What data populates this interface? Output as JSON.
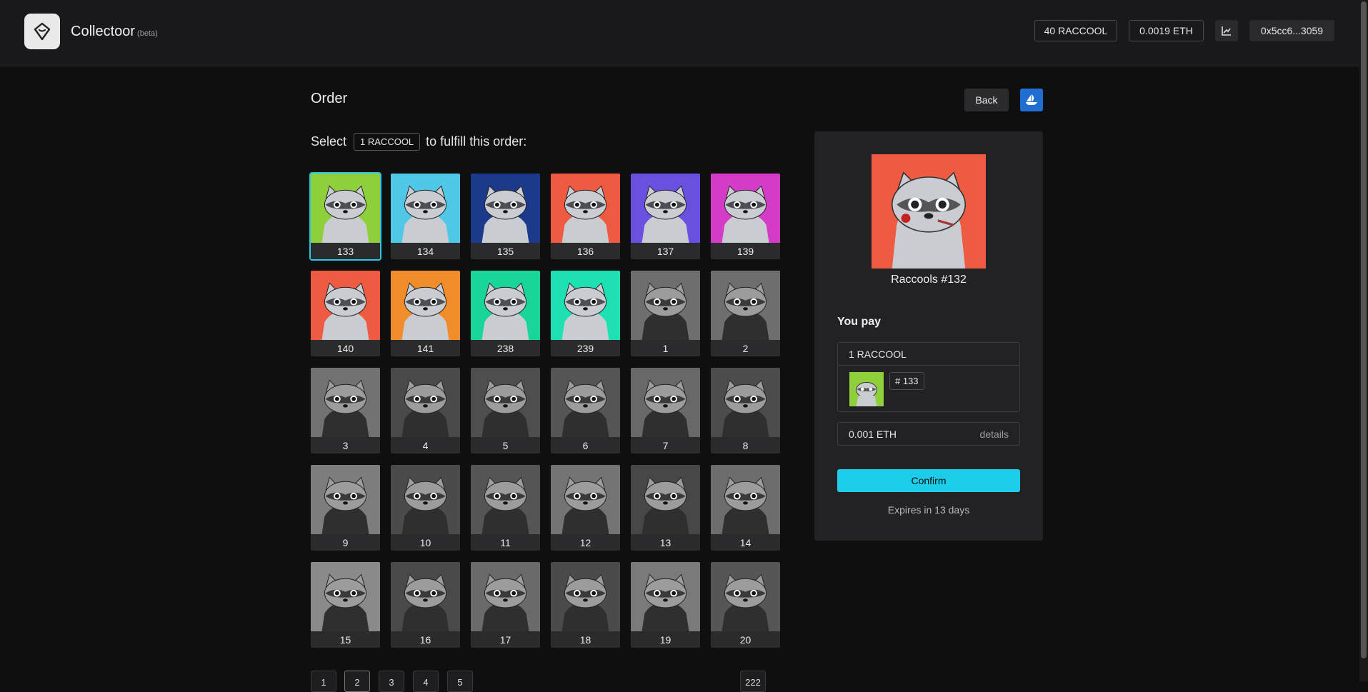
{
  "header": {
    "app_name": "Collectoor",
    "beta_label": "(beta)",
    "token_balance": "40 RACCOOL",
    "eth_balance": "0.0019 ETH",
    "chart_icon": "chart-icon",
    "wallet_address": "0x5cc6...3059"
  },
  "main": {
    "title": "Order",
    "back_label": "Back",
    "opensea_icon": "opensea-icon",
    "select_prefix": "Select",
    "select_chip": "1 RACCOOL",
    "select_suffix": "to fulfill this order:"
  },
  "nfts": [
    {
      "id": "133",
      "color": "#8fcf3c",
      "mono": false,
      "selected": true
    },
    {
      "id": "134",
      "color": "#4fc7e6",
      "mono": false
    },
    {
      "id": "135",
      "color": "#1b3a8c",
      "mono": false
    },
    {
      "id": "136",
      "color": "#ef5a43",
      "mono": false
    },
    {
      "id": "137",
      "color": "#6a4fe0",
      "mono": false
    },
    {
      "id": "139",
      "color": "#d43cc8",
      "mono": false
    },
    {
      "id": "140",
      "color": "#ef5a43",
      "mono": false
    },
    {
      "id": "141",
      "color": "#f08d2a",
      "mono": false
    },
    {
      "id": "238",
      "color": "#18d69a",
      "mono": false
    },
    {
      "id": "239",
      "color": "#1de0b3",
      "mono": false
    },
    {
      "id": "1",
      "color": "#6e6e6e",
      "mono": true
    },
    {
      "id": "2",
      "color": "#6e6e6e",
      "mono": true
    },
    {
      "id": "3",
      "color": "#727272",
      "mono": true
    },
    {
      "id": "4",
      "color": "#4a4a4a",
      "mono": true
    },
    {
      "id": "5",
      "color": "#4e4e4e",
      "mono": true
    },
    {
      "id": "6",
      "color": "#555555",
      "mono": true
    },
    {
      "id": "7",
      "color": "#686868",
      "mono": true
    },
    {
      "id": "8",
      "color": "#4c4c4c",
      "mono": true
    },
    {
      "id": "9",
      "color": "#7d7d7d",
      "mono": true
    },
    {
      "id": "10",
      "color": "#4b4b4b",
      "mono": true
    },
    {
      "id": "11",
      "color": "#555555",
      "mono": true
    },
    {
      "id": "12",
      "color": "#747474",
      "mono": true
    },
    {
      "id": "13",
      "color": "#474747",
      "mono": true
    },
    {
      "id": "14",
      "color": "#6d6d6d",
      "mono": true
    },
    {
      "id": "15",
      "color": "#8a8a8a",
      "mono": true
    },
    {
      "id": "16",
      "color": "#4a4a4a",
      "mono": true
    },
    {
      "id": "17",
      "color": "#6a6a6a",
      "mono": true
    },
    {
      "id": "18",
      "color": "#4b4b4b",
      "mono": true
    },
    {
      "id": "19",
      "color": "#7a7a7a",
      "mono": true
    },
    {
      "id": "20",
      "color": "#565656",
      "mono": true
    }
  ],
  "pagination": [
    "1",
    "2",
    "3",
    "4",
    "5",
    "222"
  ],
  "panel": {
    "nft_name": "Raccools #132",
    "nft_color": "#ef5a43",
    "you_pay_label": "You pay",
    "pay_amount": "1 RACCOOL",
    "pay_item_id": "# 133",
    "pay_item_color": "#8fcf3c",
    "eth_amount": "0.001 ETH",
    "details_label": "details",
    "confirm_label": "Confirm",
    "expires_text": "Expires in 13 days"
  },
  "colors": {
    "accent": "#1bcde8",
    "opensea_blue": "#1f6fd1"
  }
}
